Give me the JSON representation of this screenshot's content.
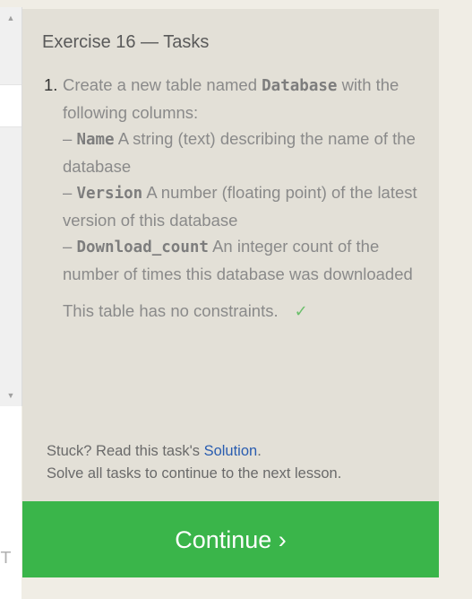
{
  "left_panel": {
    "scroll_up": "▲",
    "scroll_down": "▼",
    "bottom_letter": "T"
  },
  "panel": {
    "title": "Exercise 16 — Tasks",
    "tasks": [
      {
        "number": "1.",
        "intro_before": "Create a new table named ",
        "table_name": "Database",
        "intro_after": " with the following columns:",
        "columns": [
          {
            "dash": "– ",
            "name": "Name",
            "description": " A string (text) describing the name of the database"
          },
          {
            "dash": "– ",
            "name": "Version",
            "description": " A number (floating point) of the latest version of this database"
          },
          {
            "dash": "– ",
            "name": "Download_count",
            "description": " An integer count of the number of times this database was downloaded"
          }
        ],
        "constraint_note": "This table has no constraints.",
        "check": "✓"
      }
    ],
    "footer": {
      "stuck_before": "Stuck? Read this task's ",
      "solution_link": "Solution",
      "stuck_after": ".",
      "solve_all": "Solve all tasks to continue to the next lesson."
    }
  },
  "continue_label": "Continue ›"
}
